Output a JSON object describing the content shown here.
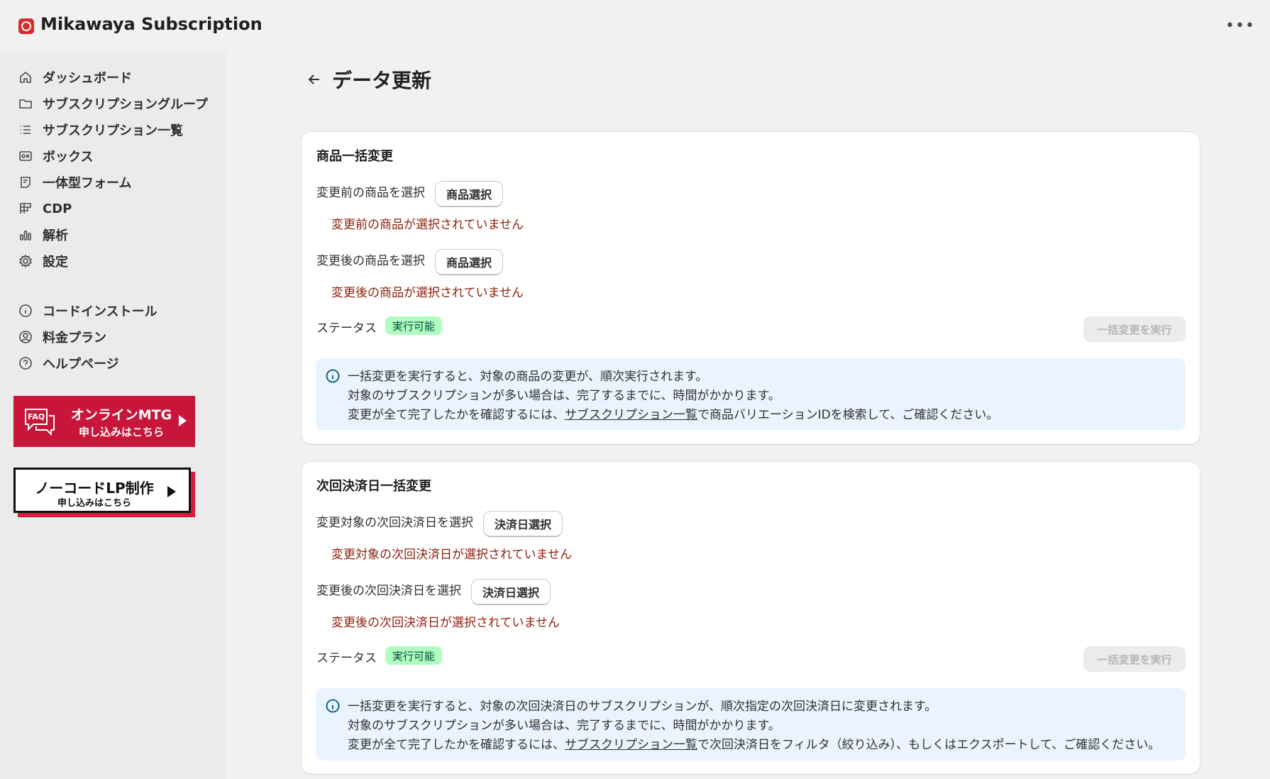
{
  "app": {
    "title": "Mikawaya Subscription"
  },
  "sidebar": {
    "items": [
      {
        "label": "ダッシュボード",
        "icon": "home-icon"
      },
      {
        "label": "サブスクリプショングループ",
        "icon": "folder-icon"
      },
      {
        "label": "サブスクリプション一覧",
        "icon": "list-icon"
      },
      {
        "label": "ボックス",
        "icon": "box-icon"
      },
      {
        "label": "一体型フォーム",
        "icon": "form-icon"
      },
      {
        "label": "CDP",
        "icon": "grid-icon"
      },
      {
        "label": "解析",
        "icon": "bar-chart-icon"
      },
      {
        "label": "設定",
        "icon": "gear-icon"
      }
    ],
    "secondary": [
      {
        "label": "コードインストール",
        "icon": "info-icon"
      },
      {
        "label": "料金プラン",
        "icon": "user-circle-icon"
      },
      {
        "label": "ヘルプページ",
        "icon": "help-icon"
      }
    ],
    "banner_online": {
      "badge": "FAQ",
      "title": "オンラインMTG",
      "subtitle": "申し込みはこちら"
    },
    "banner_nocode": {
      "title": "ノーコードLP制作",
      "subtitle": "申し込みはこちら"
    }
  },
  "page": {
    "title": "データ更新"
  },
  "product_change": {
    "title": "商品一括変更",
    "before_label": "変更前の商品を選択",
    "before_button": "商品選択",
    "before_error": "変更前の商品が選択されていません",
    "after_label": "変更後の商品を選択",
    "after_button": "商品選択",
    "after_error": "変更後の商品が選択されていません",
    "status_label": "ステータス",
    "status_badge": "実行可能",
    "execute_button": "一括変更を実行",
    "info": {
      "line1": "一括変更を実行すると、対象の商品の変更が、順次実行されます。",
      "line2": "対象のサブスクリプションが多い場合は、完了するまでに、時間がかかります。",
      "line3_prefix": "変更が全て完了したかを確認するには、",
      "line3_link": "サブスクリプション一覧",
      "line3_suffix": "で商品バリエーションIDを検索して、ご確認ください。"
    }
  },
  "billing_date_change": {
    "title": "次回決済日一括変更",
    "target_label": "変更対象の次回決済日を選択",
    "target_button": "決済日選択",
    "target_error": "変更対象の次回決済日が選択されていません",
    "after_label": "変更後の次回決済日を選択",
    "after_button": "決済日選択",
    "after_error": "変更後の次回決済日が選択されていません",
    "status_label": "ステータス",
    "status_badge": "実行可能",
    "execute_button": "一括変更を実行",
    "info": {
      "line1": "一括変更を実行すると、対象の次回決済日のサブスクリプションが、順次指定の次回決済日に変更されます。",
      "line2": "対象のサブスクリプションが多い場合は、完了するまでに、時間がかかります。",
      "line3_prefix": "変更が全て完了したかを確認するには、",
      "line3_link": "サブスクリプション一覧",
      "line3_suffix": "で次回決済日をフィルタ（絞り込み）、もしくはエクスポートして、ご確認ください。"
    }
  },
  "colors": {
    "error": "#8e1f0b",
    "badge_bg": "#affebf",
    "info_bg": "#eaf4ff",
    "banner_red": "#c8163a"
  }
}
